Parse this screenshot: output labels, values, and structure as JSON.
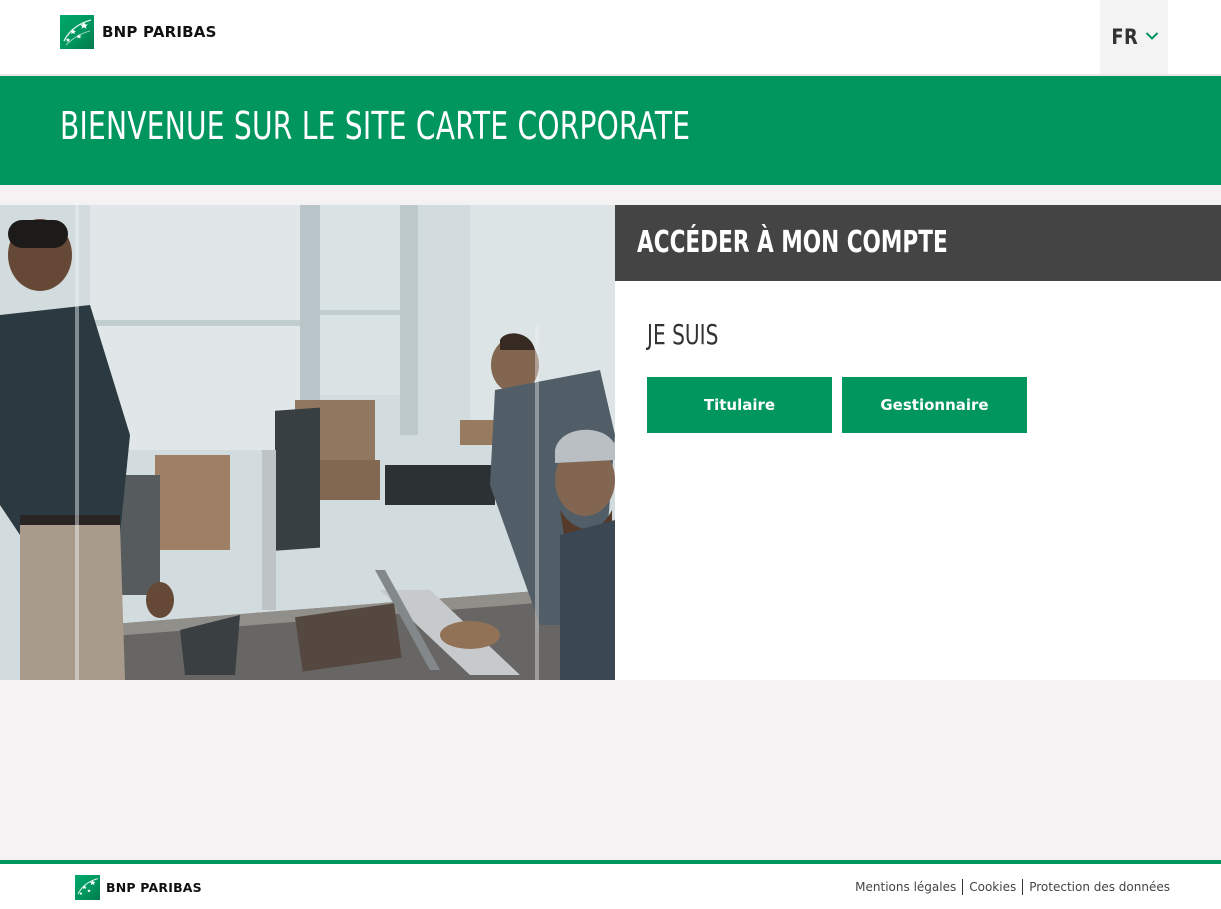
{
  "header": {
    "brand": "BNP PARIBAS",
    "language": "FR"
  },
  "banner": {
    "title": "BIENVENUE SUR LE SITE CARTE CORPORATE"
  },
  "account": {
    "title": "ACCÉDER À MON COMPTE",
    "i_am": "JE SUIS",
    "buttons": {
      "holder": "Titulaire",
      "manager": "Gestionnaire"
    }
  },
  "footer": {
    "brand": "BNP PARIBAS",
    "links": [
      "Mentions légales",
      "Cookies",
      "Protection des données"
    ]
  },
  "colors": {
    "brand_green": "#00965e",
    "panel_dark": "#444444",
    "page_bg": "#f4f2f2"
  },
  "icons": {
    "logo": "bnp-paribas-stars-logo",
    "language_chevron": "chevron-down-icon"
  }
}
